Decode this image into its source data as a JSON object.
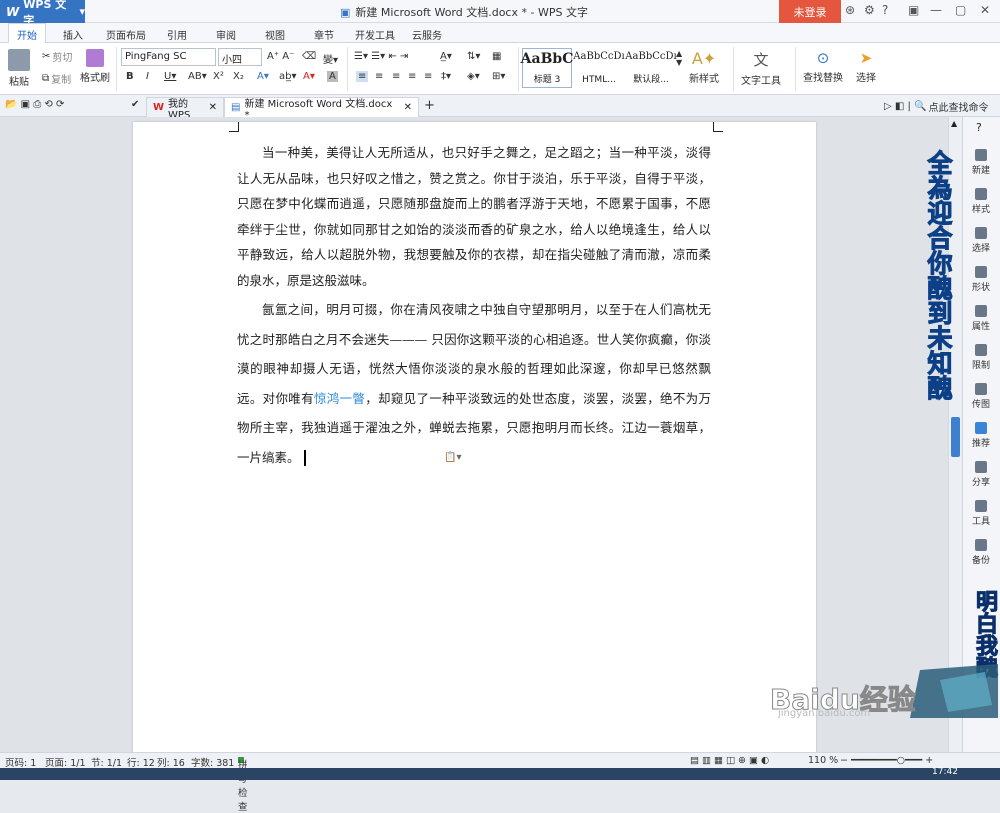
{
  "titlebar": {
    "app_label": "WPS 文字",
    "doc_title": "新建 Microsoft Word 文档.docx * - WPS 文字",
    "login_label": "未登录"
  },
  "menu": [
    "开始",
    "插入",
    "页面布局",
    "引用",
    "审阅",
    "视图",
    "章节",
    "开发工具",
    "云服务"
  ],
  "toolbar": {
    "paste": "粘贴",
    "cut": "剪切",
    "copy": "复制",
    "format_painter": "格式刷",
    "font_name": "PingFang SC",
    "font_size": "小四",
    "styles": [
      {
        "preview": "AaBbC",
        "label": "标题 3"
      },
      {
        "preview": "AaBbCcDı",
        "label": "HTML..."
      },
      {
        "preview": "AaBbCcDı",
        "label": "默认段..."
      }
    ],
    "new_style": "新样式",
    "text_tool": "文字工具",
    "find_replace": "查找替换",
    "select": "选择"
  },
  "tabs": {
    "tab1": "我的WPS",
    "tab2": "新建 Microsoft Word 文档.docx *",
    "search": "点此查找命令"
  },
  "document": {
    "p1": "当一种美，美得让人无所适从，也只好手之舞之，足之蹈之；当一种平淡，淡得让人无从品味，也只好叹之惜之，赞之赏之。你甘于淡泊，乐于平淡，自得于平淡，只愿在梦中化蝶而逍遥，只愿随那盘旋而上的鹏者浮游于天地，不愿累于国事，不愿牵绊于尘世，你就如同那甘之如饴的淡淡而香的矿泉之水，给人以绝境逢生，给人以平静致远，给人以超脱外物，我想要触及你的衣襟，却在指尖碰触了清而澈，凉而柔的泉水，原是这般滋味。",
    "p2a": "氤氲之间，明月可掇，你在清风夜啸之中独自守望那明月，以至于在人们高枕无忧之时那皓白之月不会迷失———  只因你这颗平淡的心相追逐。世人笑你疯癫，你淡漠的眼神却摄人无语，恍然大悟你淡淡的泉水般的哲理如此深邃，你却早已悠然飘远。对你唯有",
    "p2_link": "惊鸿一瞥",
    "p2b": "，却窥见了一种平淡致远的处世态度，淡罢，淡罢，绝不为万物所主宰，我独逍遥于濯浊之外，蝉蜕去拖累，只愿抱明月而长终。江边一蓑烟草，一片缟素。"
  },
  "sidebar": [
    "新建",
    "样式",
    "选择",
    "形状",
    "属性",
    "限制",
    "传图",
    "推荐",
    "分享",
    "工具",
    "备份"
  ],
  "watermark": {
    "vertical1": "全為迎合你醜到未知醜",
    "vertical2": "明白我醜",
    "baidu": "Baidu经验",
    "baidu_url": "jingyan.baidu.com"
  },
  "status": {
    "page": "页码: 1",
    "pages": "页面: 1/1",
    "section": "节: 1/1",
    "row": "行: 12",
    "col": "列: 16",
    "words": "字数: 381",
    "spell": "拼写检查",
    "zoom": "110 %",
    "clock": "17:42"
  }
}
